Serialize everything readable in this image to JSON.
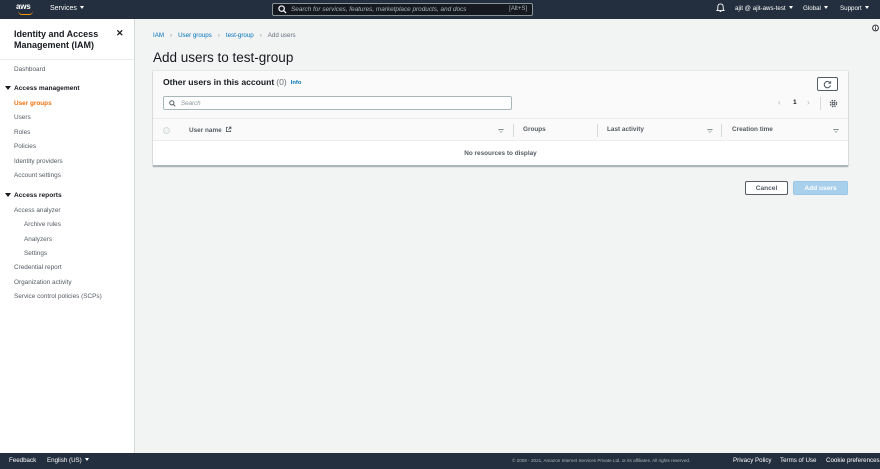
{
  "topnav": {
    "logo_text": "aws",
    "services_label": "Services",
    "search_placeholder": "Search for services, features, marketplace products, and docs",
    "search_shortcut": "[Alt+S]",
    "account_label": "ajit @ ajit-aws-test",
    "region_label": "Global",
    "support_label": "Support",
    "colors": {
      "bar": "#232f3e",
      "accent": "#ff9900"
    }
  },
  "sidebar": {
    "title": "Identity and Access Management (IAM)",
    "close_icon": "close-icon",
    "dashboard": "Dashboard",
    "access_management": {
      "label": "Access management",
      "items": [
        "User groups",
        "Users",
        "Roles",
        "Policies",
        "Identity providers",
        "Account settings"
      ],
      "active": "User groups"
    },
    "access_reports": {
      "label": "Access reports",
      "analyzer": "Access analyzer",
      "analyzer_children": [
        "Archive rules",
        "Analyzers",
        "Settings"
      ],
      "items": [
        "Credential report",
        "Organization activity",
        "Service control policies (SCPs)"
      ]
    },
    "colors": {
      "active": "#ec7211"
    }
  },
  "breadcrumb": [
    "IAM",
    "User groups",
    "test-group",
    "Add users"
  ],
  "page_title": "Add users to test-group",
  "panel": {
    "title": "Other users in this account",
    "count": "(0)",
    "info": "Info",
    "search_placeholder": "Search",
    "page_number": "1",
    "columns": [
      "User name",
      "Groups",
      "Last activity",
      "Creation time"
    ],
    "empty_message": "No resources to display"
  },
  "actions": {
    "cancel": "Cancel",
    "add_users": "Add users",
    "colors": {
      "primary_disabled": "#a8cfec"
    }
  },
  "footer": {
    "feedback": "Feedback",
    "language": "English (US)",
    "copyright": "© 2008 - 2021, Amazon Internet Services Private Ltd. or its affiliates. All rights reserved.",
    "privacy": "Privacy Policy",
    "terms": "Terms of Use",
    "cookies": "Cookie preferences"
  }
}
